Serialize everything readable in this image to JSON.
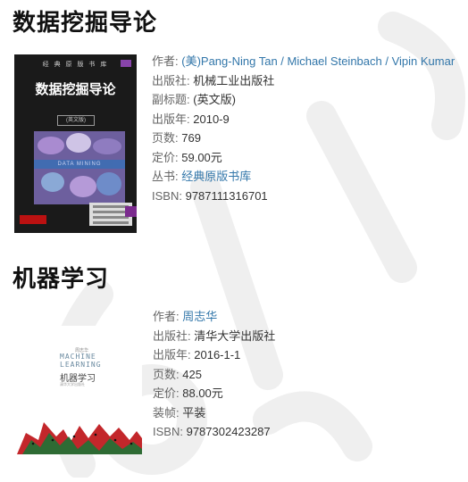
{
  "books": [
    {
      "title": "数据挖掘导论",
      "cover": {
        "series_text": "经 典 原 版 书 库",
        "title": "数据挖掘导论",
        "edition": "(英文版)",
        "band_text": "DATA MINING"
      },
      "fields": {
        "author_label": "作者:",
        "author_value": "(美)Pang-Ning Tan / Michael Steinbach / Vipin Kumar",
        "publisher_label": "出版社:",
        "publisher_value": "机械工业出版社",
        "subtitle_label": "副标题:",
        "subtitle_value": "(英文版)",
        "year_label": "出版年:",
        "year_value": "2010-9",
        "pages_label": "页数:",
        "pages_value": "769",
        "price_label": "定价:",
        "price_value": "59.00元",
        "series_label": "丛书:",
        "series_value": "经典原版书库",
        "isbn_label": "ISBN:",
        "isbn_value": "9787111316701"
      }
    },
    {
      "title": "机器学习",
      "cover": {
        "author_small": "周志华",
        "english_title": "MACHINE\nLEARNING",
        "title": "机器学习",
        "publisher_small": "清华大学出版社"
      },
      "fields": {
        "author_label": "作者:",
        "author_value": "周志华",
        "publisher_label": "出版社:",
        "publisher_value": "清华大学出版社",
        "year_label": "出版年:",
        "year_value": "2016-1-1",
        "pages_label": "页数:",
        "pages_value": "425",
        "price_label": "定价:",
        "price_value": "88.00元",
        "binding_label": "装帧:",
        "binding_value": "平装",
        "isbn_label": "ISBN:",
        "isbn_value": "9787302423287"
      }
    }
  ],
  "watermark": {
    "text": "cnblogs"
  },
  "colors": {
    "link": "#3377aa",
    "title": "#111111",
    "text": "#333333",
    "watermark": "#eeeeee"
  }
}
